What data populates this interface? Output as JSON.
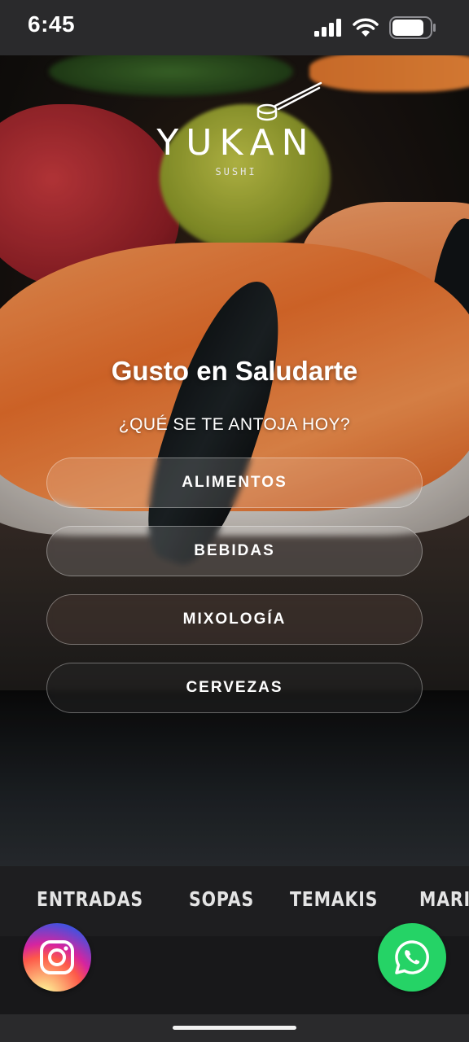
{
  "status_bar": {
    "time": "6:45"
  },
  "logo": {
    "name": "YUKAN",
    "subtitle": "SUSHI"
  },
  "greeting": {
    "title": "Gusto en Saludarte",
    "prompt": "¿QUÉ SE TE ANTOJA HOY?"
  },
  "menu": {
    "items": [
      {
        "label": "ALIMENTOS"
      },
      {
        "label": "BEBIDAS"
      },
      {
        "label": "MIXOLOGÍA"
      },
      {
        "label": "CERVEZAS"
      }
    ]
  },
  "categories": {
    "items": [
      {
        "label": "ENTRADAS"
      },
      {
        "label": "SOPAS"
      },
      {
        "label": "TEMAKIS"
      },
      {
        "label": "MARISCOS"
      }
    ]
  },
  "colors": {
    "whatsapp": "#25d366",
    "status_bar_bg": "#2a2a2c",
    "category_bar_bg": "#1e1e20"
  },
  "icons": {
    "instagram": "instagram-icon",
    "whatsapp": "whatsapp-icon"
  }
}
